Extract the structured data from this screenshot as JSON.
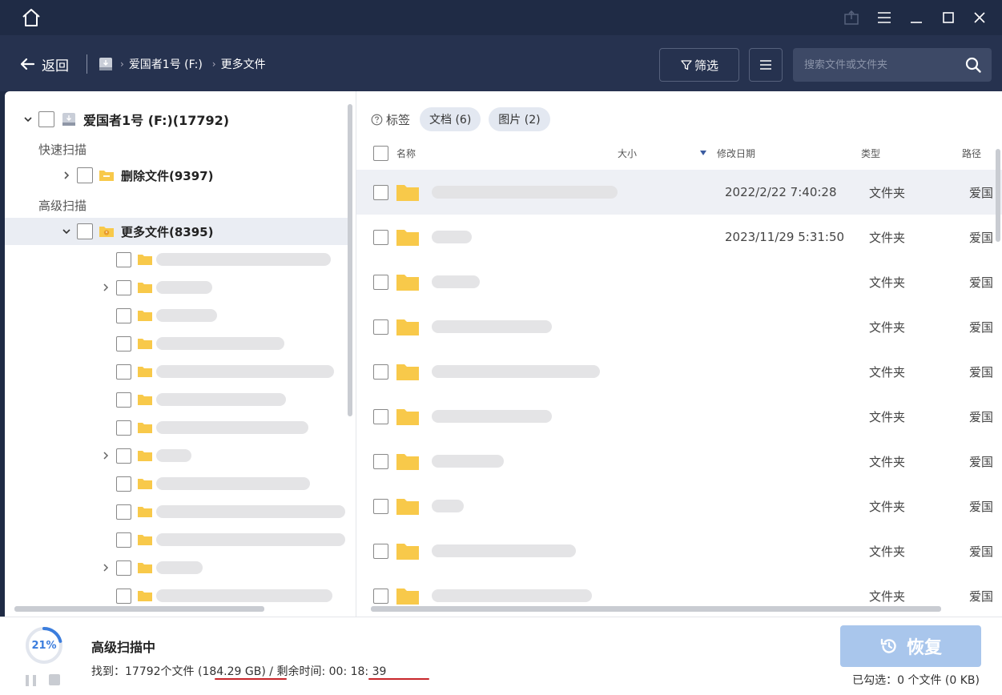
{
  "nav": {
    "back_label": "返回",
    "breadcrumb": [
      "爱国者1号 (F:)",
      "更多文件"
    ],
    "filter_label": "筛选",
    "search_placeholder": "搜索文件或文件夹"
  },
  "tree": {
    "drive_label": "爱国者1号 (F:)(17792)",
    "quick_scan_label": "快速扫描",
    "deleted_files_label": "删除文件(9397)",
    "advanced_scan_label": "高级扫描",
    "more_files_label": "更多文件(8395)"
  },
  "tags": {
    "label": "标签",
    "chips": [
      "文档 (6)",
      "图片 (2)"
    ]
  },
  "columns": {
    "name": "名称",
    "size": "大小",
    "modified": "修改日期",
    "type": "类型",
    "path": "路径"
  },
  "files": [
    {
      "date": "2022/2/22 7:40:28",
      "type": "文件夹",
      "path": "爱国"
    },
    {
      "date": "2023/11/29 5:31:50",
      "type": "文件夹",
      "path": "爱国"
    },
    {
      "date": "",
      "type": "文件夹",
      "path": "爱国"
    },
    {
      "date": "",
      "type": "文件夹",
      "path": "爱国"
    },
    {
      "date": "",
      "type": "文件夹",
      "path": "爱国"
    },
    {
      "date": "",
      "type": "文件夹",
      "path": "爱国"
    },
    {
      "date": "",
      "type": "文件夹",
      "path": "爱国"
    },
    {
      "date": "",
      "type": "文件夹",
      "path": "爱国"
    },
    {
      "date": "",
      "type": "文件夹",
      "path": "爱国"
    },
    {
      "date": "",
      "type": "文件夹",
      "path": "爱国"
    }
  ],
  "footer": {
    "progress": "21%",
    "progress_value": 0.21,
    "scan_title": "高级扫描中",
    "found_prefix": "找到：17792个文件 ",
    "found_size": "(184.29 GB)",
    "remaining_label": " / 剩余时间:  ",
    "remaining_time": "00: 18: 39",
    "recover_label": "恢复",
    "selected_info": "已勾选：0 个文件 (0 KB)"
  },
  "colors": {
    "titlebar": "#1f2b45",
    "navbar": "#26324f",
    "folder": "#f8c94a",
    "accent": "#3b7ddd",
    "recover_disabled": "#a9c6ec",
    "annotation_red": "#c8262b"
  }
}
